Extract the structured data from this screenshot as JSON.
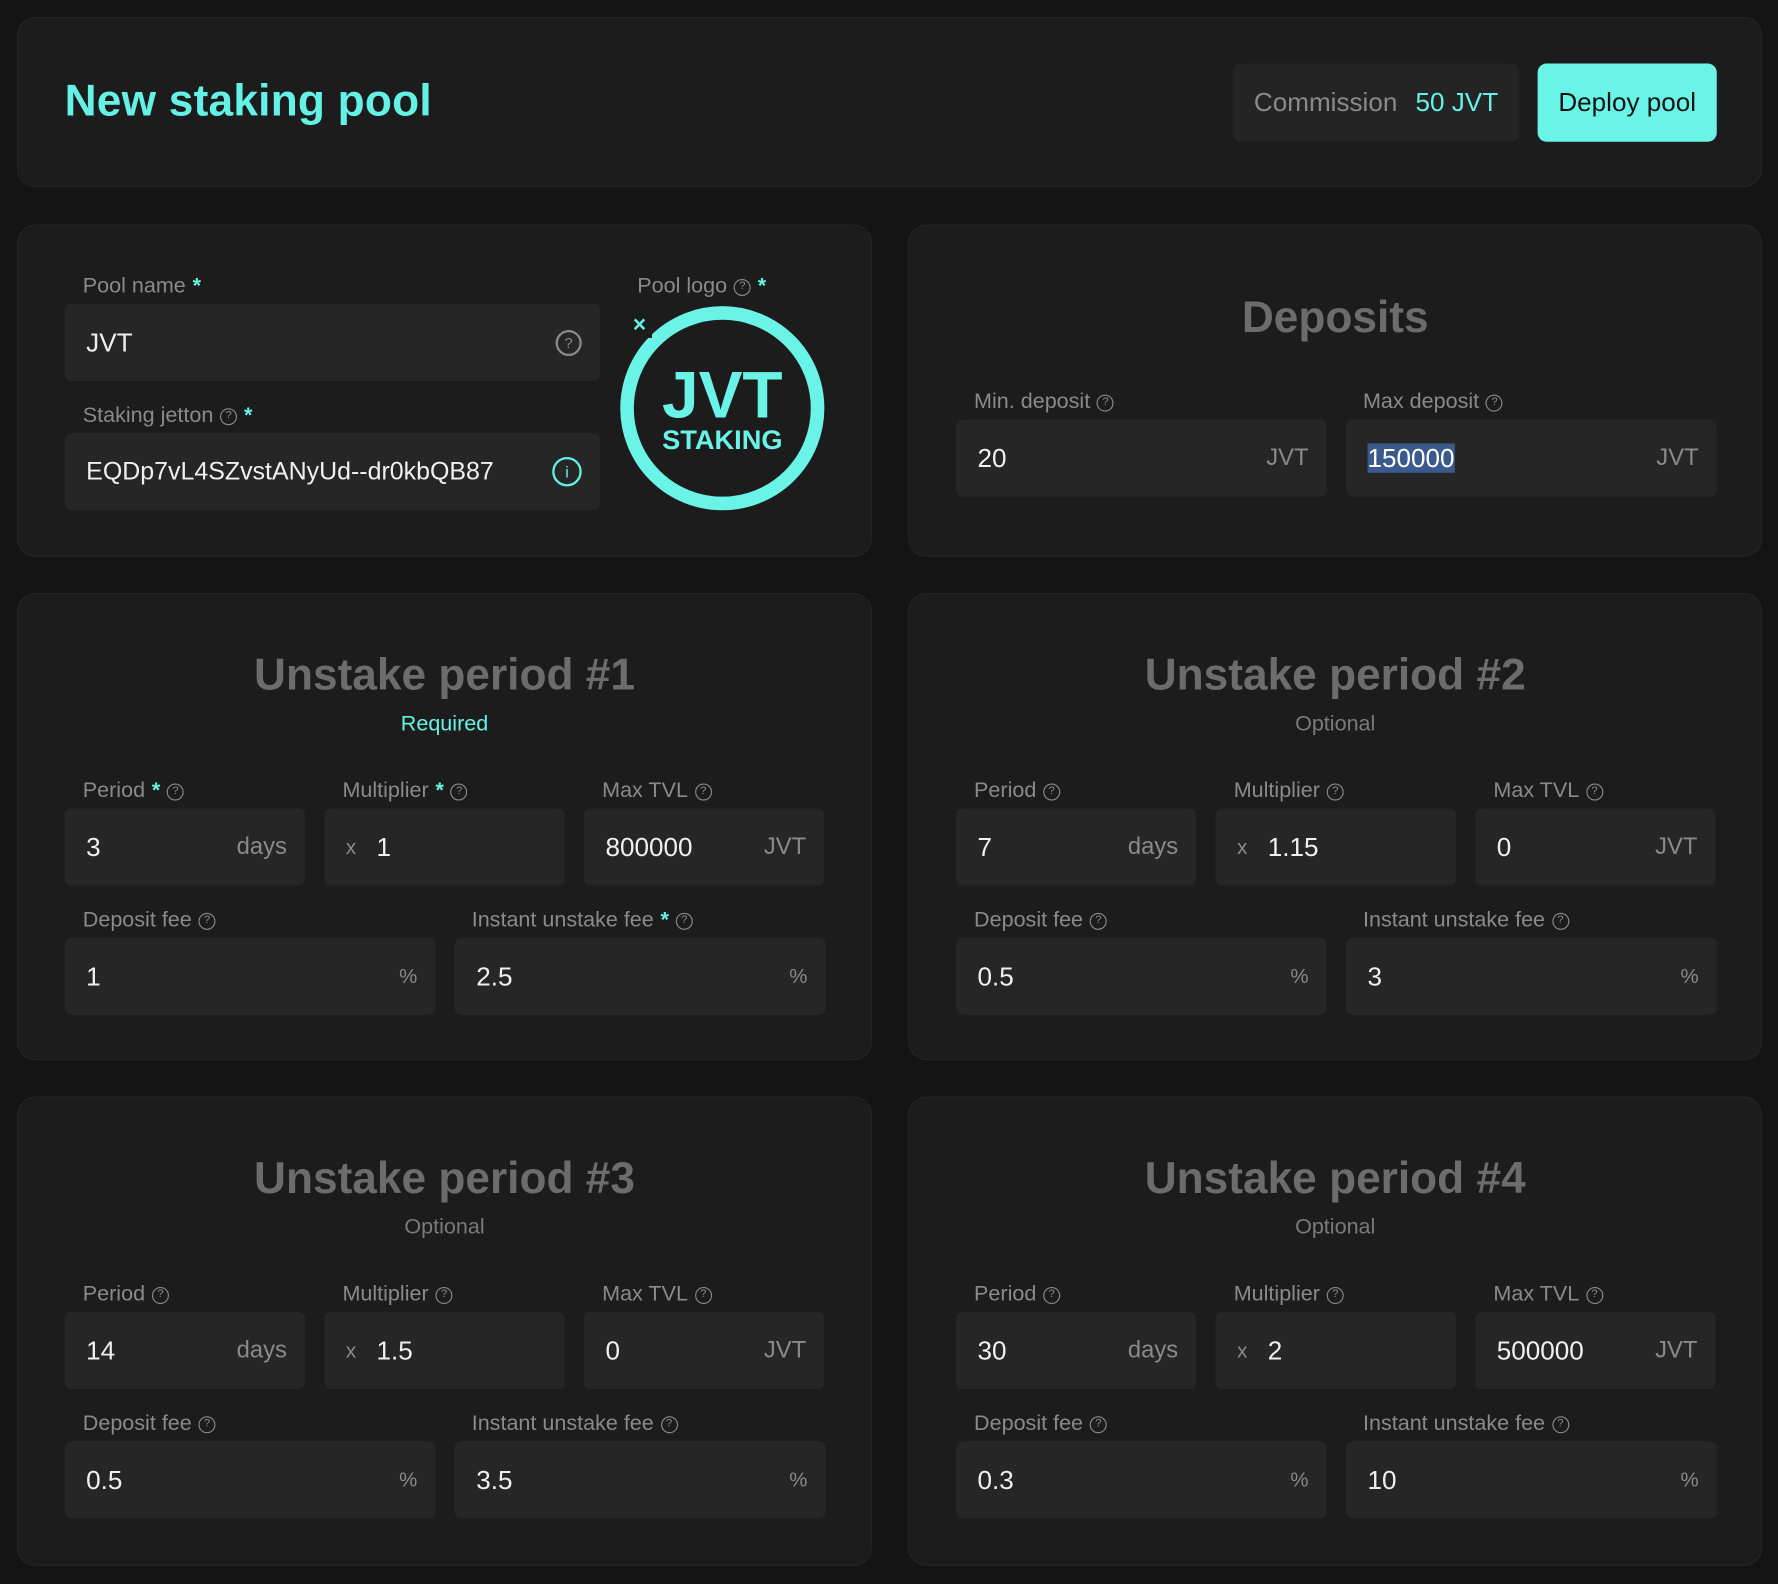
{
  "header": {
    "title": "New staking pool",
    "commission_label": "Commission",
    "commission_value": "50 JVT",
    "deploy_label": "Deploy pool"
  },
  "pool": {
    "name_label": "Pool name",
    "name_value": "JVT",
    "jetton_label": "Staking jetton",
    "jetton_value": "EQDp7vL4SZvstANyUd--dr0kbQB87",
    "logo_label": "Pool logo",
    "logo_text_main": "JVT",
    "logo_text_sub": "STAKING",
    "logo_close": "×",
    "required_mark": "*"
  },
  "deposits": {
    "title": "Deposits",
    "min_label": "Min. deposit",
    "min_value": "20",
    "max_label": "Max deposit",
    "max_value": "150000",
    "unit": "JVT"
  },
  "labels": {
    "period": "Period",
    "multiplier": "Multiplier",
    "max_tvl": "Max TVL",
    "deposit_fee": "Deposit fee",
    "instant_fee": "Instant unstake fee",
    "days": "days",
    "x": "x",
    "jvt": "JVT",
    "pct": "%",
    "q": "?"
  },
  "periods": [
    {
      "title": "Unstake period #1",
      "subtitle": "Required",
      "period": "3",
      "multiplier": "1",
      "max_tvl": "800000",
      "deposit_fee": "1",
      "instant_fee": "2.5"
    },
    {
      "title": "Unstake period #2",
      "subtitle": "Optional",
      "period": "7",
      "multiplier": "1.15",
      "max_tvl": "0",
      "deposit_fee": "0.5",
      "instant_fee": "3"
    },
    {
      "title": "Unstake period #3",
      "subtitle": "Optional",
      "period": "14",
      "multiplier": "1.5",
      "max_tvl": "0",
      "deposit_fee": "0.5",
      "instant_fee": "3.5"
    },
    {
      "title": "Unstake period #4",
      "subtitle": "Optional",
      "period": "30",
      "multiplier": "2",
      "max_tvl": "500000",
      "deposit_fee": "0.3",
      "instant_fee": "10"
    }
  ]
}
